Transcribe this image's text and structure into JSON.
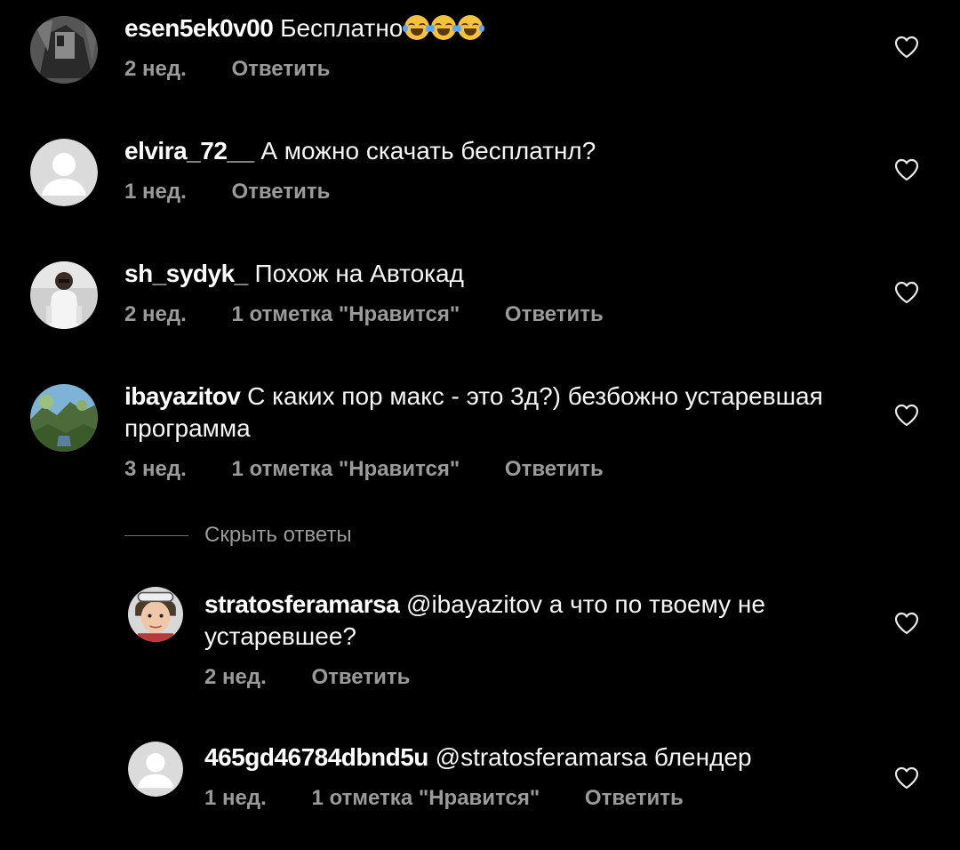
{
  "colors": {
    "background": "#000000",
    "text": "#f5f5f5",
    "meta": "#9a9a9a"
  },
  "comments": [
    {
      "username": "esen5ek0v00",
      "text": "Бесплатно",
      "emojis": [
        "face-with-tears-of-joy",
        "face-with-tears-of-joy",
        "face-with-tears-of-joy"
      ],
      "time": "2 нед.",
      "likes": "",
      "reply": "Ответить",
      "avatar_icon": "photo-avatar-dark"
    },
    {
      "username": "elvira_72__",
      "text": "А можно скачать бесплатнл?",
      "time": "1 нед.",
      "likes": "",
      "reply": "Ответить",
      "avatar_icon": "default-avatar"
    },
    {
      "username": "sh_sydyk_",
      "text": "Похож на Автокад",
      "time": "2 нед.",
      "likes": "1 отметка \"Нравится\"",
      "reply": "Ответить",
      "avatar_icon": "photo-avatar-person"
    },
    {
      "username": "ibayazitov",
      "text": "С каких пор макс - это 3д?) безбожно устаревшая программа",
      "time": "3 нед.",
      "likes": "1 отметка \"Нравится\"",
      "reply": "Ответить",
      "avatar_icon": "photo-avatar-landscape"
    }
  ],
  "hide_replies": "Скрыть ответы",
  "replies": [
    {
      "username": "stratosferamarsa",
      "text": "@ibayazitov а что по твоему не устаревшее?",
      "time": "2 нед.",
      "likes": "",
      "reply": "Ответить",
      "avatar_icon": "photo-avatar-child"
    },
    {
      "username": "465gd46784dbnd5u",
      "text": "@stratosferamarsa блендер",
      "time": "1 нед.",
      "likes": "1 отметка \"Нравится\"",
      "reply": "Ответить",
      "avatar_icon": "default-avatar"
    }
  ]
}
